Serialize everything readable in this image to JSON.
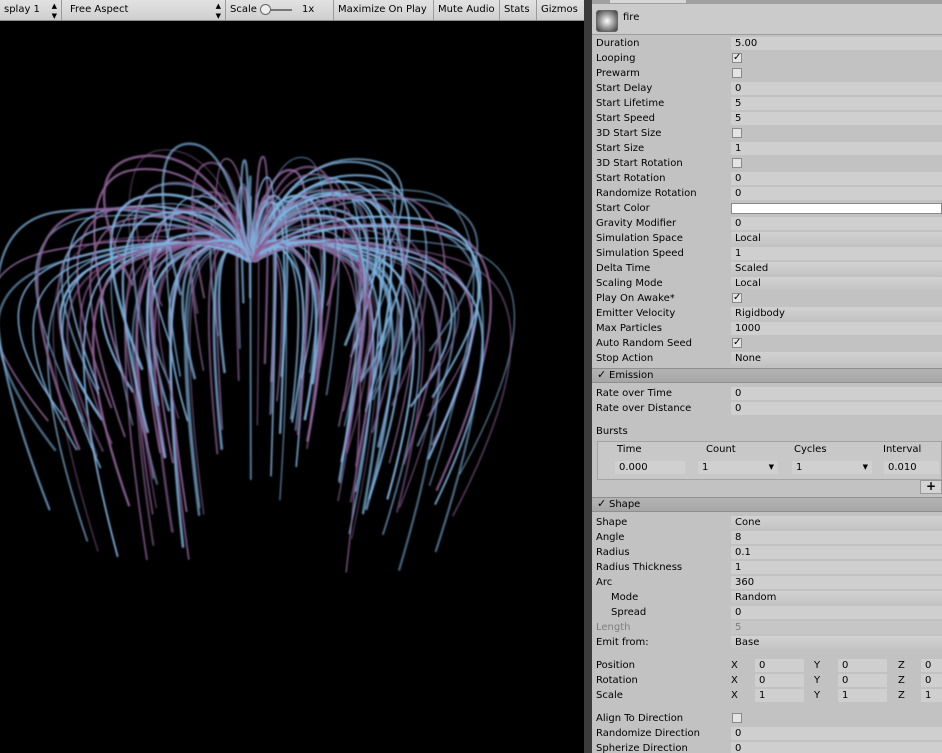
{
  "game_toolbar": {
    "display": "splay 1",
    "aspect": "Free Aspect",
    "scale_label": "Scale",
    "scale_value": "1x",
    "maximize_on_play": "Maximize On Play",
    "mute_audio": "Mute Audio",
    "stats": "Stats",
    "gizmos": "Gizmos"
  },
  "inspector": {
    "system_name": "fire",
    "main_rows": [
      {
        "label": "Duration",
        "type": "text",
        "value": "5.00"
      },
      {
        "label": "Looping",
        "type": "check",
        "checked": true
      },
      {
        "label": "Prewarm",
        "type": "check",
        "checked": false
      },
      {
        "label": "Start Delay",
        "type": "text",
        "value": "0"
      },
      {
        "label": "Start Lifetime",
        "type": "text",
        "value": "5"
      },
      {
        "label": "Start Speed",
        "type": "text",
        "value": "5"
      },
      {
        "label": "3D Start Size",
        "type": "check",
        "checked": false
      },
      {
        "label": "Start Size",
        "type": "text",
        "value": "1"
      },
      {
        "label": "3D Start Rotation",
        "type": "check",
        "checked": false
      },
      {
        "label": "Start Rotation",
        "type": "text",
        "value": "0"
      },
      {
        "label": "Randomize Rotation",
        "type": "text",
        "value": "0"
      },
      {
        "label": "Start Color",
        "type": "color",
        "color": "#ffffff"
      },
      {
        "label": "Gravity Modifier",
        "type": "text",
        "value": "0"
      },
      {
        "label": "Simulation Space",
        "type": "dropdown",
        "value": "Local"
      },
      {
        "label": "Simulation Speed",
        "type": "text",
        "value": "1"
      },
      {
        "label": "Delta Time",
        "type": "dropdown",
        "value": "Scaled"
      },
      {
        "label": "Scaling Mode",
        "type": "dropdown",
        "value": "Local"
      },
      {
        "label": "Play On Awake*",
        "type": "check",
        "checked": true
      },
      {
        "label": "Emitter Velocity",
        "type": "dropdown",
        "value": "Rigidbody"
      },
      {
        "label": "Max Particles",
        "type": "text",
        "value": "1000"
      },
      {
        "label": "Auto Random Seed",
        "type": "check",
        "checked": true
      },
      {
        "label": "Stop Action",
        "type": "dropdown",
        "value": "None"
      }
    ],
    "emission": {
      "title": "Emission",
      "rate_over_time_label": "Rate over Time",
      "rate_over_time": "0",
      "rate_over_distance_label": "Rate over Distance",
      "rate_over_distance": "0",
      "bursts_label": "Bursts",
      "bursts_headers": {
        "time": "Time",
        "count": "Count",
        "cycles": "Cycles",
        "interval": "Interval"
      },
      "burst": {
        "time": "0.000",
        "count": "1",
        "cycles": "1",
        "interval": "0.010"
      },
      "add_symbol": "+"
    },
    "shape": {
      "title": "Shape",
      "rows": [
        {
          "label": "Shape",
          "type": "dropdown",
          "value": "Cone"
        },
        {
          "label": "Angle",
          "type": "text",
          "value": "8"
        },
        {
          "label": "Radius",
          "type": "text",
          "value": "0.1"
        },
        {
          "label": "Radius Thickness",
          "type": "text",
          "value": "1"
        },
        {
          "label": "Arc",
          "type": "text",
          "value": "360"
        },
        {
          "label": "Mode",
          "type": "dropdown",
          "value": "Random",
          "indent": true
        },
        {
          "label": "Spread",
          "type": "text",
          "value": "0",
          "indent": true
        },
        {
          "label": "Length",
          "type": "text",
          "value": "5",
          "disabled": true
        },
        {
          "label": "Emit from:",
          "type": "dropdown",
          "value": "Base"
        }
      ],
      "transform": [
        {
          "label": "Position",
          "x": "0",
          "y": "0",
          "z": "0"
        },
        {
          "label": "Rotation",
          "x": "0",
          "y": "0",
          "z": "0"
        },
        {
          "label": "Scale",
          "x": "1",
          "y": "1",
          "z": "1"
        }
      ],
      "axis": {
        "x": "X",
        "y": "Y",
        "z": "Z"
      },
      "align_label": "Align To Direction",
      "randomize_label": "Randomize Direction",
      "randomize_value": "0",
      "spherize_label": "Spherize Direction",
      "spherize_value": "0"
    }
  },
  "colors": {
    "viewport_bg": "#000000",
    "panel_bg": "#c2c2c2",
    "particle_blue": "#7fb3e0",
    "particle_purple": "#8a5f94"
  }
}
